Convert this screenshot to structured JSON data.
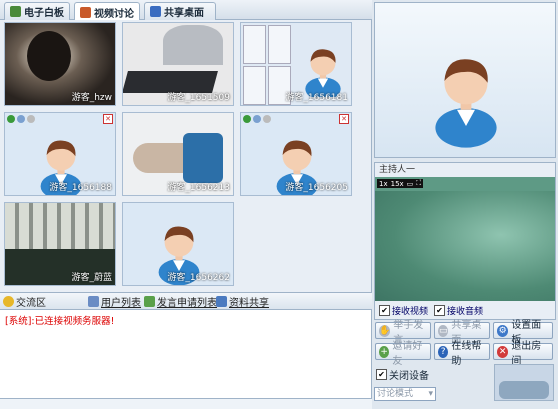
{
  "tabs": [
    {
      "label": "电子白板",
      "active": false
    },
    {
      "label": "视频讨论",
      "active": true
    },
    {
      "label": "共享桌面",
      "active": false
    }
  ],
  "video_cells": [
    {
      "label": "游客_hzw"
    },
    {
      "label": "游客_1651509"
    },
    {
      "label": "游客_1656181"
    },
    {
      "label": "游客_1656188"
    },
    {
      "label": "游客_1656213"
    },
    {
      "label": "游客_1656205"
    },
    {
      "label": "游客_蔚蓝"
    },
    {
      "label": "游客_1656262"
    }
  ],
  "host_panel": {
    "title": "主持人一",
    "video_bar": [
      "1x",
      "15x",
      "▭",
      "⛶"
    ],
    "receive_video": "接收视频",
    "receive_audio": "接收音频"
  },
  "buttons": {
    "raise_hand": "举手发言",
    "share_desktop": "共享桌面",
    "settings": "设置面板",
    "invite": "邀请好友",
    "help": "在线帮助",
    "exit": "退出房间"
  },
  "close_device": "关闭设备",
  "mode_select": "讨论模式",
  "chat_bar": {
    "exchange": "交流区",
    "user_list": "用户列表",
    "speak_requests": "发言申请列表",
    "file_share": "资料共享"
  },
  "chat_log": [
    "[系统]:已连接视频务服器!"
  ],
  "colors": {
    "accent": "#2a63b8",
    "system_msg": "#dd0000",
    "host_bg": "#5e9a85"
  }
}
